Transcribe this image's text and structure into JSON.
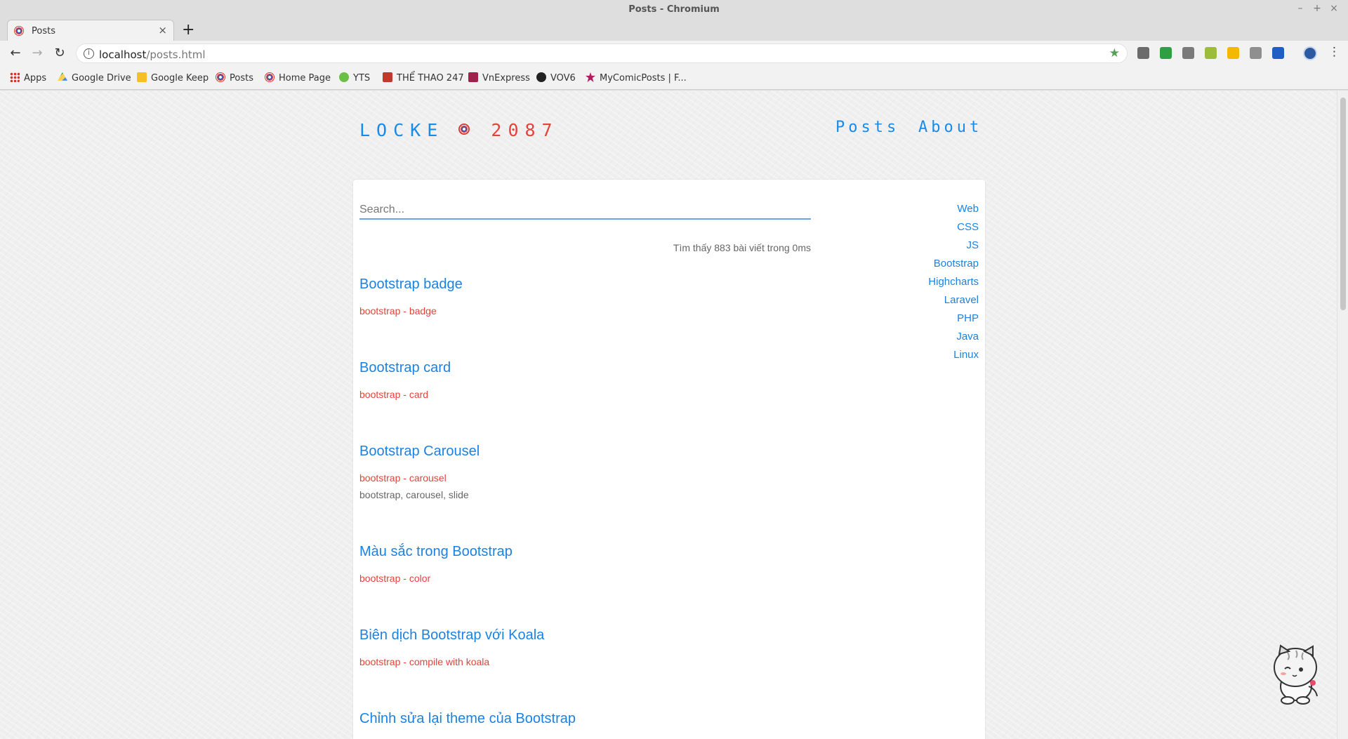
{
  "window": {
    "title": "Posts - Chromium"
  },
  "tabs": [
    {
      "label": "Posts"
    }
  ],
  "address": {
    "host": "localhost",
    "path": "/posts.html"
  },
  "bookmarks": [
    {
      "label": "Apps",
      "icon": "apps-icon"
    },
    {
      "label": "Google Drive",
      "icon": "google-drive-icon"
    },
    {
      "label": "Google Keep",
      "icon": "google-keep-icon"
    },
    {
      "label": "Posts",
      "icon": "captain-america-shield-icon"
    },
    {
      "label": "Home Page",
      "icon": "captain-america-shield-icon"
    },
    {
      "label": "YTS",
      "icon": "yts-icon"
    },
    {
      "label": "THỂ THAO 247",
      "icon": "thethao-icon"
    },
    {
      "label": "VnExpress",
      "icon": "vnexpress-icon"
    },
    {
      "label": "VOV6",
      "icon": "vov-icon"
    },
    {
      "label": "MyComicPosts | F...",
      "icon": "comic-icon"
    }
  ],
  "site": {
    "logo_part1": "LOCKE",
    "logo_part2": "2087",
    "nav": [
      "Posts",
      "About"
    ]
  },
  "search": {
    "placeholder": "Search...",
    "result_text": "Tìm thấy 883 bài viết trong 0ms"
  },
  "posts": [
    {
      "title": "Bootstrap badge",
      "category": "bootstrap - badge",
      "tags": ""
    },
    {
      "title": "Bootstrap card",
      "category": "bootstrap - card",
      "tags": ""
    },
    {
      "title": "Bootstrap Carousel",
      "category": "bootstrap - carousel",
      "tags": "bootstrap, carousel, slide"
    },
    {
      "title": "Màu sắc trong Bootstrap",
      "category": "bootstrap - color",
      "tags": ""
    },
    {
      "title": "Biên dịch Bootstrap với Koala",
      "category": "bootstrap - compile with koala",
      "tags": ""
    },
    {
      "title": "Chỉnh sửa lại theme của Bootstrap",
      "category": "",
      "tags": ""
    }
  ],
  "categories": [
    "Web",
    "CSS",
    "JS",
    "Bootstrap",
    "Highcharts",
    "Laravel",
    "PHP",
    "Java",
    "Linux"
  ],
  "colors": {
    "accent": "#1a82e2",
    "brand_red": "#e8413a"
  }
}
